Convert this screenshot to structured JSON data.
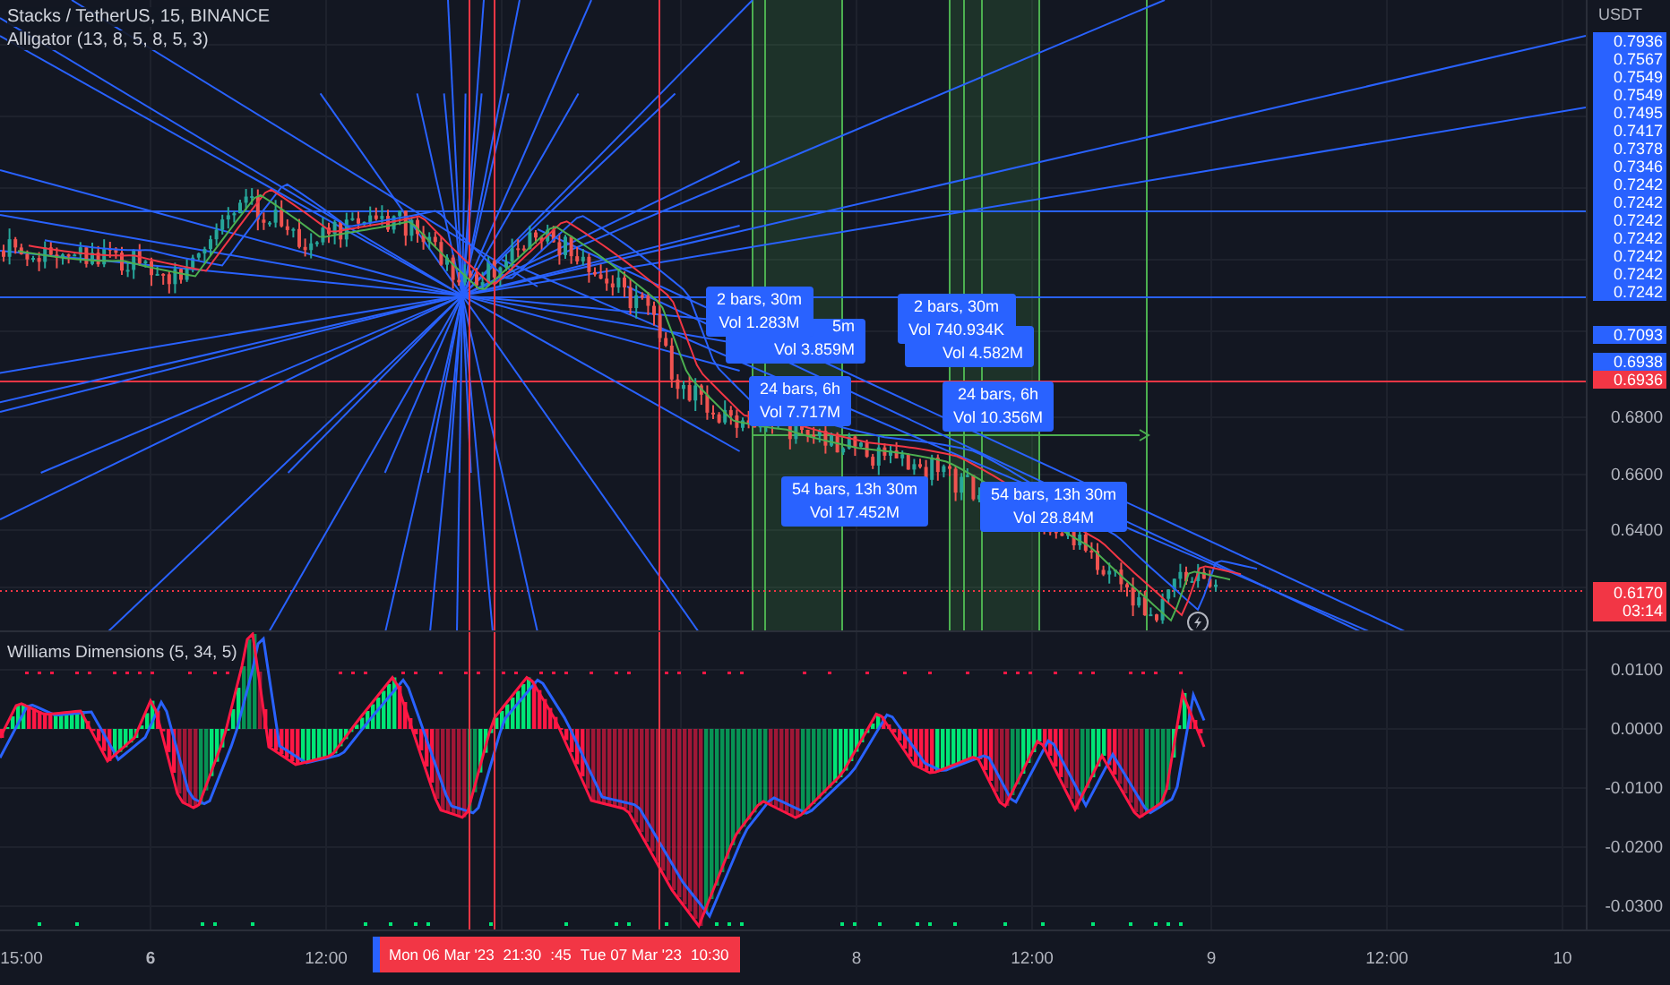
{
  "header": {
    "title": "Stacks / TetherUS, 15, BINANCE",
    "indicator": "Alligator (13, 8, 5, 8, 5, 3)"
  },
  "price_axis": {
    "unit": "USDT",
    "ticks": [
      "0.6800",
      "0.6600",
      "0.6400"
    ],
    "labels": [
      {
        "text": "0.7936",
        "color": "#2962ff"
      },
      {
        "text": "0.7567",
        "color": "#2962ff"
      },
      {
        "text": "0.7549",
        "color": "#2962ff"
      },
      {
        "text": "0.7549",
        "color": "#2962ff"
      },
      {
        "text": "0.7495",
        "color": "#2962ff"
      },
      {
        "text": "0.7417",
        "color": "#2962ff"
      },
      {
        "text": "0.7378",
        "color": "#2962ff"
      },
      {
        "text": "0.7346",
        "color": "#2962ff"
      },
      {
        "text": "0.7242",
        "color": "#2962ff"
      },
      {
        "text": "0.7242",
        "color": "#2962ff"
      },
      {
        "text": "0.7242",
        "color": "#2962ff"
      },
      {
        "text": "0.7242",
        "color": "#2962ff"
      },
      {
        "text": "0.7242",
        "color": "#2962ff"
      },
      {
        "text": "0.7242",
        "color": "#2962ff"
      },
      {
        "text": "0.7242",
        "color": "#2962ff"
      }
    ],
    "markers": [
      {
        "text": "0.7093",
        "color": "#2962ff"
      },
      {
        "text": "0.6938",
        "color": "#2962ff"
      },
      {
        "text": "0.6936",
        "color": "#f23645"
      }
    ],
    "last_price": {
      "price": "0.6170",
      "countdown": "03:14"
    }
  },
  "measurements": [
    {
      "lines": [
        "2 bars, 30m",
        "Vol 1.283M"
      ]
    },
    {
      "lines": [
        "5m",
        "Vol 3.859M"
      ]
    },
    {
      "lines": [
        "24 bars, 6h",
        "Vol 7.717M"
      ]
    },
    {
      "lines": [
        "54 bars, 13h 30m",
        "Vol 17.452M"
      ]
    },
    {
      "lines": [
        "2 bars, 30m",
        "Vol 740.934K"
      ]
    },
    {
      "lines": [
        "Vol 4.582M"
      ]
    },
    {
      "lines": [
        "24 bars, 6h",
        "Vol 10.356M"
      ]
    },
    {
      "lines": [
        "54 bars, 13h 30m",
        "Vol 28.84M"
      ]
    }
  ],
  "oscillator": {
    "title": "Williams Dimensions (5, 34, 5)",
    "ticks": [
      "0.0100",
      "0.0000",
      "-0.0100",
      "-0.0200",
      "-0.0300"
    ]
  },
  "time_axis": {
    "ticks": [
      "15:00",
      "6",
      "12:00",
      "8",
      "12:00",
      "9",
      "12:00",
      "10"
    ],
    "range": [
      "Mon 06 Mar '23",
      "21:30",
      ":45",
      "Tue 07 Mar '23",
      "10:30"
    ]
  }
}
